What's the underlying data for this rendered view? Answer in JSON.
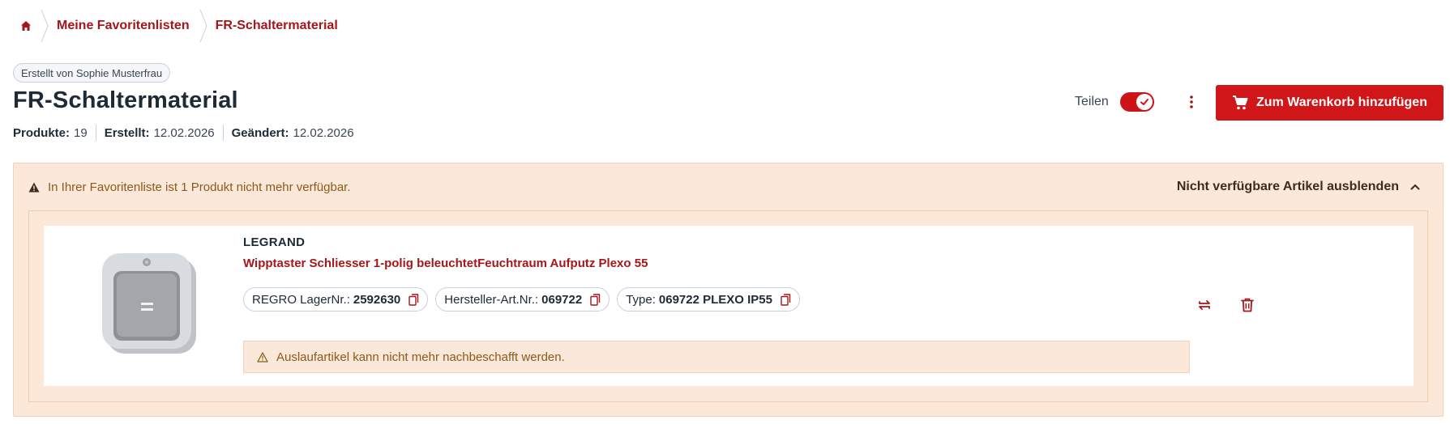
{
  "breadcrumb": {
    "home_icon": "home-icon",
    "items": [
      "Meine Favoritenlisten",
      "FR-Schaltermaterial"
    ]
  },
  "creator_badge": "Erstellt von Sophie Musterfrau",
  "title": "FR-Schaltermaterial",
  "meta": {
    "products_label": "Produkte:",
    "products_value": "19",
    "created_label": "Erstellt:",
    "created_value": "12.02.2026",
    "changed_label": "Geändert:",
    "changed_value": "12.02.2026"
  },
  "share": {
    "label": "Teilen",
    "enabled": true
  },
  "cart_button": {
    "label": "Zum Warenkorb hinzufügen",
    "icon": "cart-icon"
  },
  "unavailable": {
    "message": "In Ihrer Favoritenliste ist 1 Produkt nicht mehr verfügbar.",
    "toggle_label": "Nicht verfügbare Artikel ausblenden",
    "products": [
      {
        "brand": "LEGRAND",
        "name": "Wipptaster Schliesser 1-polig beleuchtetFeuchtraum Aufputz Plexo 55",
        "ids": [
          {
            "label": "REGRO LagerNr.:",
            "value": "2592630"
          },
          {
            "label": "Hersteller-Art.Nr.:",
            "value": "069722"
          },
          {
            "label": "Type:",
            "value": "069722 PLEXO IP55"
          }
        ],
        "notice": "Auslaufartikel kann nicht mehr nachbeschafft werden."
      }
    ]
  },
  "colors": {
    "brand_red": "#d1161a",
    "link_red": "#a4161a",
    "warning_bg": "#fbe8d9",
    "warning_text": "#8a5a1c",
    "text_dark": "#1f2a37"
  }
}
